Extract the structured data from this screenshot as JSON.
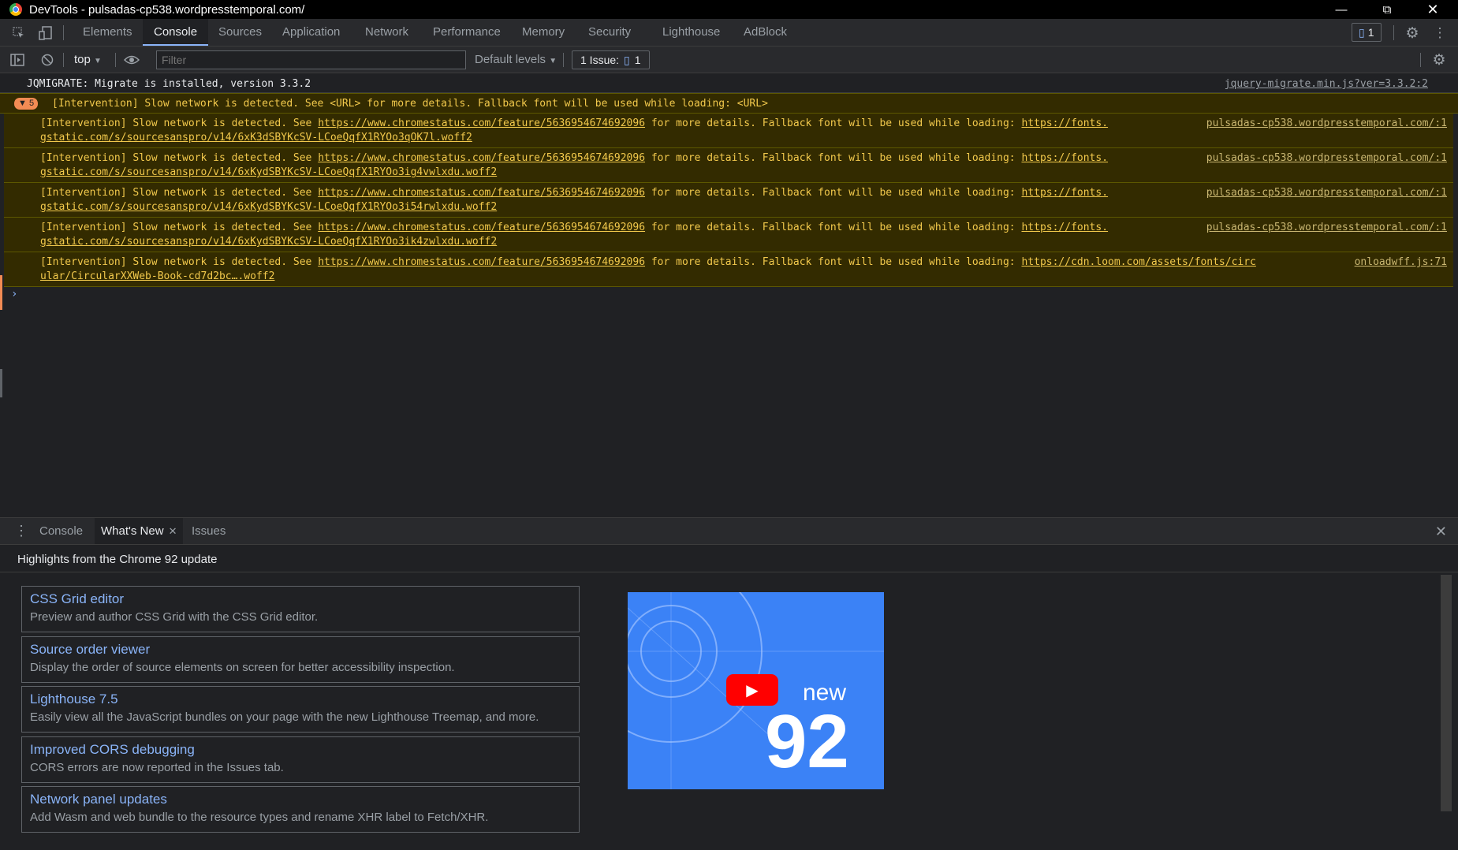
{
  "window": {
    "title": "DevTools - pulsadas-cp538.wordpresstemporal.com/"
  },
  "tabs": [
    "Elements",
    "Console",
    "Sources",
    "Application",
    "Network",
    "Performance",
    "Memory",
    "Security",
    "Lighthouse",
    "AdBlock"
  ],
  "active_tab": "Console",
  "header_badge": {
    "count": "1"
  },
  "toolbar": {
    "context": "top",
    "filter_placeholder": "Filter",
    "levels": "Default levels",
    "issues_label": "1 Issue:",
    "issues_count": "1"
  },
  "console": {
    "info": {
      "text": "JQMIGRATE: Migrate is installed, version 3.3.2",
      "source": "jquery-migrate.min.js?ver=3.3.2:2"
    },
    "group": {
      "count": "5",
      "text": "[Intervention] Slow network is detected. See <URL> for more details. Fallback font will be used while loading: <URL>"
    },
    "warnings": [
      {
        "prefix": "[Intervention] Slow network is detected. See ",
        "link": "https://www.chromestatus.com/feature/5636954674692096",
        "mid": " for more details. Fallback font will be used while loading: ",
        "url1": "https://fonts.",
        "url2": "gstatic.com/s/sourcesanspro/v14/6xK3dSBYKcSV-LCoeQqfX1RYOo3qOK7l.woff2",
        "source": "pulsadas-cp538.wordpresstemporal.com/:1"
      },
      {
        "prefix": "[Intervention] Slow network is detected. See ",
        "link": "https://www.chromestatus.com/feature/5636954674692096",
        "mid": " for more details. Fallback font will be used while loading: ",
        "url1": "https://fonts.",
        "url2": "gstatic.com/s/sourcesanspro/v14/6xKydSBYKcSV-LCoeQqfX1RYOo3ig4vwlxdu.woff2",
        "source": "pulsadas-cp538.wordpresstemporal.com/:1"
      },
      {
        "prefix": "[Intervention] Slow network is detected. See ",
        "link": "https://www.chromestatus.com/feature/5636954674692096",
        "mid": " for more details. Fallback font will be used while loading: ",
        "url1": "https://fonts.",
        "url2": "gstatic.com/s/sourcesanspro/v14/6xKydSBYKcSV-LCoeQqfX1RYOo3i54rwlxdu.woff2",
        "source": "pulsadas-cp538.wordpresstemporal.com/:1"
      },
      {
        "prefix": "[Intervention] Slow network is detected. See ",
        "link": "https://www.chromestatus.com/feature/5636954674692096",
        "mid": " for more details. Fallback font will be used while loading: ",
        "url1": "https://fonts.",
        "url2": "gstatic.com/s/sourcesanspro/v14/6xKydSBYKcSV-LCoeQqfX1RYOo3ik4zwlxdu.woff2",
        "source": "pulsadas-cp538.wordpresstemporal.com/:1"
      },
      {
        "prefix": "[Intervention] Slow network is detected. See ",
        "link": "https://www.chromestatus.com/feature/5636954674692096",
        "mid": " for more details. Fallback font will be used while loading: ",
        "url1": "https://cdn.loom.com/assets/fonts/circ",
        "url2": "ular/CircularXXWeb-Book-cd7d2bc….woff2",
        "source": "onloadwff.js:71"
      }
    ]
  },
  "drawer": {
    "tabs": [
      "Console",
      "What's New",
      "Issues"
    ],
    "active_tab": "What's New",
    "highlights_title": "Highlights from the Chrome 92 update",
    "features": [
      {
        "title": "CSS Grid editor",
        "desc": "Preview and author CSS Grid with the CSS Grid editor."
      },
      {
        "title": "Source order viewer",
        "desc": "Display the order of source elements on screen for better accessibility inspection."
      },
      {
        "title": "Lighthouse 7.5",
        "desc": "Easily view all the JavaScript bundles on your page with the new Lighthouse Treemap, and more."
      },
      {
        "title": "Improved CORS debugging",
        "desc": "CORS errors are now reported in the Issues tab."
      },
      {
        "title": "Network panel updates",
        "desc": "Add Wasm and web bundle to the resource types and rename XHR label to Fetch/XHR."
      }
    ],
    "video": {
      "word": "new",
      "number": "92"
    }
  }
}
